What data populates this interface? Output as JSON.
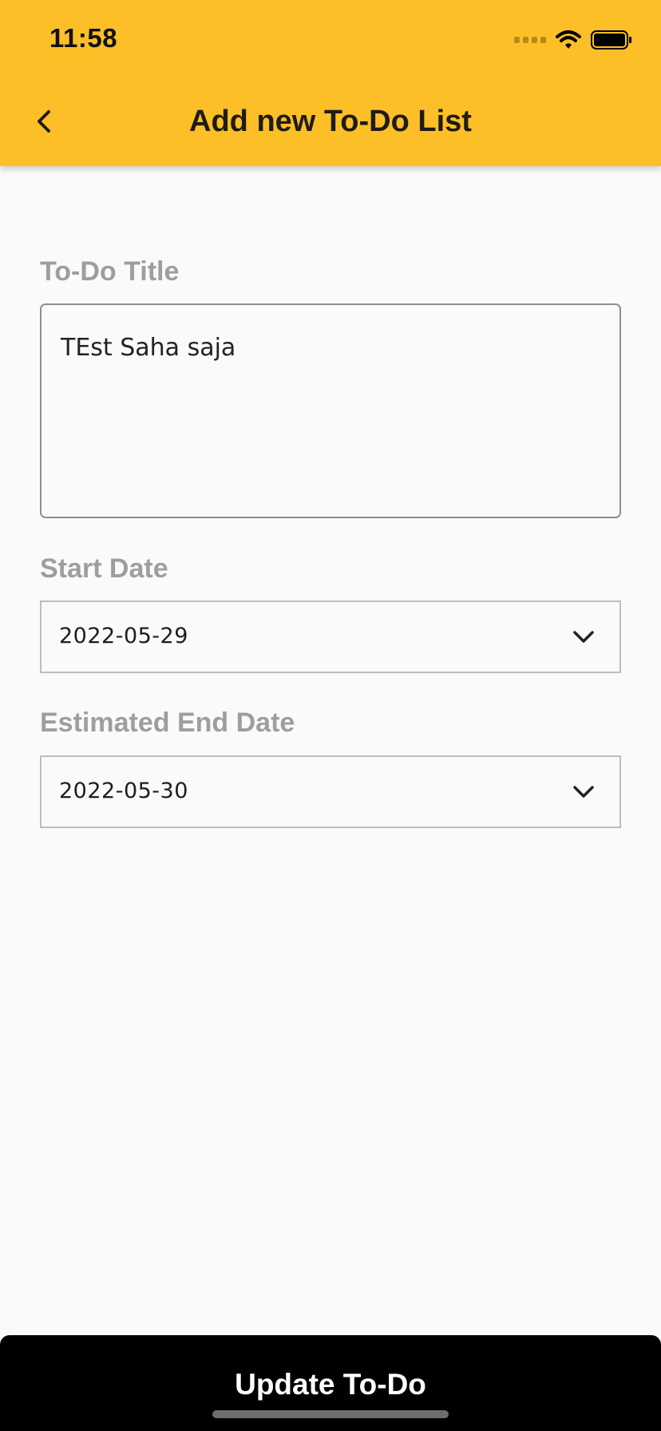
{
  "status_bar": {
    "time": "11:58"
  },
  "header": {
    "title": "Add new To-Do List",
    "back_icon": "chevron-left-icon",
    "background_color": "#fdbf27"
  },
  "form": {
    "title_label": "To-Do Title",
    "title_value": "TEst Saha saja",
    "start_date_label": "Start Date",
    "start_date_value": "2022-05-29",
    "end_date_label": "Estimated End Date",
    "end_date_value": "2022-05-30",
    "dropdown_icon": "chevron-down-icon"
  },
  "footer": {
    "button_label": "Update To-Do",
    "button_color": "#000000"
  }
}
